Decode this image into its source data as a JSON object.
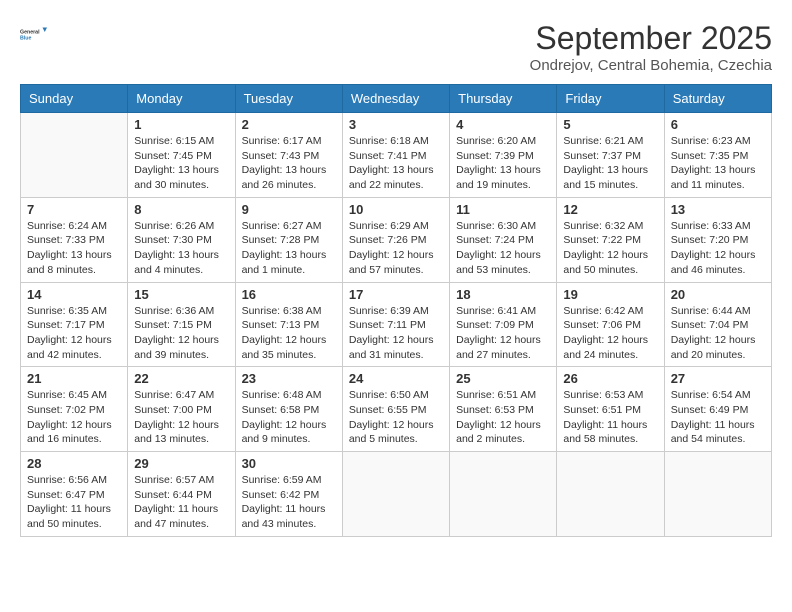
{
  "logo": {
    "line1": "General",
    "line2": "Blue"
  },
  "title": "September 2025",
  "subtitle": "Ondrejov, Central Bohemia, Czechia",
  "weekdays": [
    "Sunday",
    "Monday",
    "Tuesday",
    "Wednesday",
    "Thursday",
    "Friday",
    "Saturday"
  ],
  "weeks": [
    [
      {
        "day": "",
        "sunrise": "",
        "sunset": "",
        "daylight": ""
      },
      {
        "day": "1",
        "sunrise": "Sunrise: 6:15 AM",
        "sunset": "Sunset: 7:45 PM",
        "daylight": "Daylight: 13 hours and 30 minutes."
      },
      {
        "day": "2",
        "sunrise": "Sunrise: 6:17 AM",
        "sunset": "Sunset: 7:43 PM",
        "daylight": "Daylight: 13 hours and 26 minutes."
      },
      {
        "day": "3",
        "sunrise": "Sunrise: 6:18 AM",
        "sunset": "Sunset: 7:41 PM",
        "daylight": "Daylight: 13 hours and 22 minutes."
      },
      {
        "day": "4",
        "sunrise": "Sunrise: 6:20 AM",
        "sunset": "Sunset: 7:39 PM",
        "daylight": "Daylight: 13 hours and 19 minutes."
      },
      {
        "day": "5",
        "sunrise": "Sunrise: 6:21 AM",
        "sunset": "Sunset: 7:37 PM",
        "daylight": "Daylight: 13 hours and 15 minutes."
      },
      {
        "day": "6",
        "sunrise": "Sunrise: 6:23 AM",
        "sunset": "Sunset: 7:35 PM",
        "daylight": "Daylight: 13 hours and 11 minutes."
      }
    ],
    [
      {
        "day": "7",
        "sunrise": "Sunrise: 6:24 AM",
        "sunset": "Sunset: 7:33 PM",
        "daylight": "Daylight: 13 hours and 8 minutes."
      },
      {
        "day": "8",
        "sunrise": "Sunrise: 6:26 AM",
        "sunset": "Sunset: 7:30 PM",
        "daylight": "Daylight: 13 hours and 4 minutes."
      },
      {
        "day": "9",
        "sunrise": "Sunrise: 6:27 AM",
        "sunset": "Sunset: 7:28 PM",
        "daylight": "Daylight: 13 hours and 1 minute."
      },
      {
        "day": "10",
        "sunrise": "Sunrise: 6:29 AM",
        "sunset": "Sunset: 7:26 PM",
        "daylight": "Daylight: 12 hours and 57 minutes."
      },
      {
        "day": "11",
        "sunrise": "Sunrise: 6:30 AM",
        "sunset": "Sunset: 7:24 PM",
        "daylight": "Daylight: 12 hours and 53 minutes."
      },
      {
        "day": "12",
        "sunrise": "Sunrise: 6:32 AM",
        "sunset": "Sunset: 7:22 PM",
        "daylight": "Daylight: 12 hours and 50 minutes."
      },
      {
        "day": "13",
        "sunrise": "Sunrise: 6:33 AM",
        "sunset": "Sunset: 7:20 PM",
        "daylight": "Daylight: 12 hours and 46 minutes."
      }
    ],
    [
      {
        "day": "14",
        "sunrise": "Sunrise: 6:35 AM",
        "sunset": "Sunset: 7:17 PM",
        "daylight": "Daylight: 12 hours and 42 minutes."
      },
      {
        "day": "15",
        "sunrise": "Sunrise: 6:36 AM",
        "sunset": "Sunset: 7:15 PM",
        "daylight": "Daylight: 12 hours and 39 minutes."
      },
      {
        "day": "16",
        "sunrise": "Sunrise: 6:38 AM",
        "sunset": "Sunset: 7:13 PM",
        "daylight": "Daylight: 12 hours and 35 minutes."
      },
      {
        "day": "17",
        "sunrise": "Sunrise: 6:39 AM",
        "sunset": "Sunset: 7:11 PM",
        "daylight": "Daylight: 12 hours and 31 minutes."
      },
      {
        "day": "18",
        "sunrise": "Sunrise: 6:41 AM",
        "sunset": "Sunset: 7:09 PM",
        "daylight": "Daylight: 12 hours and 27 minutes."
      },
      {
        "day": "19",
        "sunrise": "Sunrise: 6:42 AM",
        "sunset": "Sunset: 7:06 PM",
        "daylight": "Daylight: 12 hours and 24 minutes."
      },
      {
        "day": "20",
        "sunrise": "Sunrise: 6:44 AM",
        "sunset": "Sunset: 7:04 PM",
        "daylight": "Daylight: 12 hours and 20 minutes."
      }
    ],
    [
      {
        "day": "21",
        "sunrise": "Sunrise: 6:45 AM",
        "sunset": "Sunset: 7:02 PM",
        "daylight": "Daylight: 12 hours and 16 minutes."
      },
      {
        "day": "22",
        "sunrise": "Sunrise: 6:47 AM",
        "sunset": "Sunset: 7:00 PM",
        "daylight": "Daylight: 12 hours and 13 minutes."
      },
      {
        "day": "23",
        "sunrise": "Sunrise: 6:48 AM",
        "sunset": "Sunset: 6:58 PM",
        "daylight": "Daylight: 12 hours and 9 minutes."
      },
      {
        "day": "24",
        "sunrise": "Sunrise: 6:50 AM",
        "sunset": "Sunset: 6:55 PM",
        "daylight": "Daylight: 12 hours and 5 minutes."
      },
      {
        "day": "25",
        "sunrise": "Sunrise: 6:51 AM",
        "sunset": "Sunset: 6:53 PM",
        "daylight": "Daylight: 12 hours and 2 minutes."
      },
      {
        "day": "26",
        "sunrise": "Sunrise: 6:53 AM",
        "sunset": "Sunset: 6:51 PM",
        "daylight": "Daylight: 11 hours and 58 minutes."
      },
      {
        "day": "27",
        "sunrise": "Sunrise: 6:54 AM",
        "sunset": "Sunset: 6:49 PM",
        "daylight": "Daylight: 11 hours and 54 minutes."
      }
    ],
    [
      {
        "day": "28",
        "sunrise": "Sunrise: 6:56 AM",
        "sunset": "Sunset: 6:47 PM",
        "daylight": "Daylight: 11 hours and 50 minutes."
      },
      {
        "day": "29",
        "sunrise": "Sunrise: 6:57 AM",
        "sunset": "Sunset: 6:44 PM",
        "daylight": "Daylight: 11 hours and 47 minutes."
      },
      {
        "day": "30",
        "sunrise": "Sunrise: 6:59 AM",
        "sunset": "Sunset: 6:42 PM",
        "daylight": "Daylight: 11 hours and 43 minutes."
      },
      {
        "day": "",
        "sunrise": "",
        "sunset": "",
        "daylight": ""
      },
      {
        "day": "",
        "sunrise": "",
        "sunset": "",
        "daylight": ""
      },
      {
        "day": "",
        "sunrise": "",
        "sunset": "",
        "daylight": ""
      },
      {
        "day": "",
        "sunrise": "",
        "sunset": "",
        "daylight": ""
      }
    ]
  ]
}
